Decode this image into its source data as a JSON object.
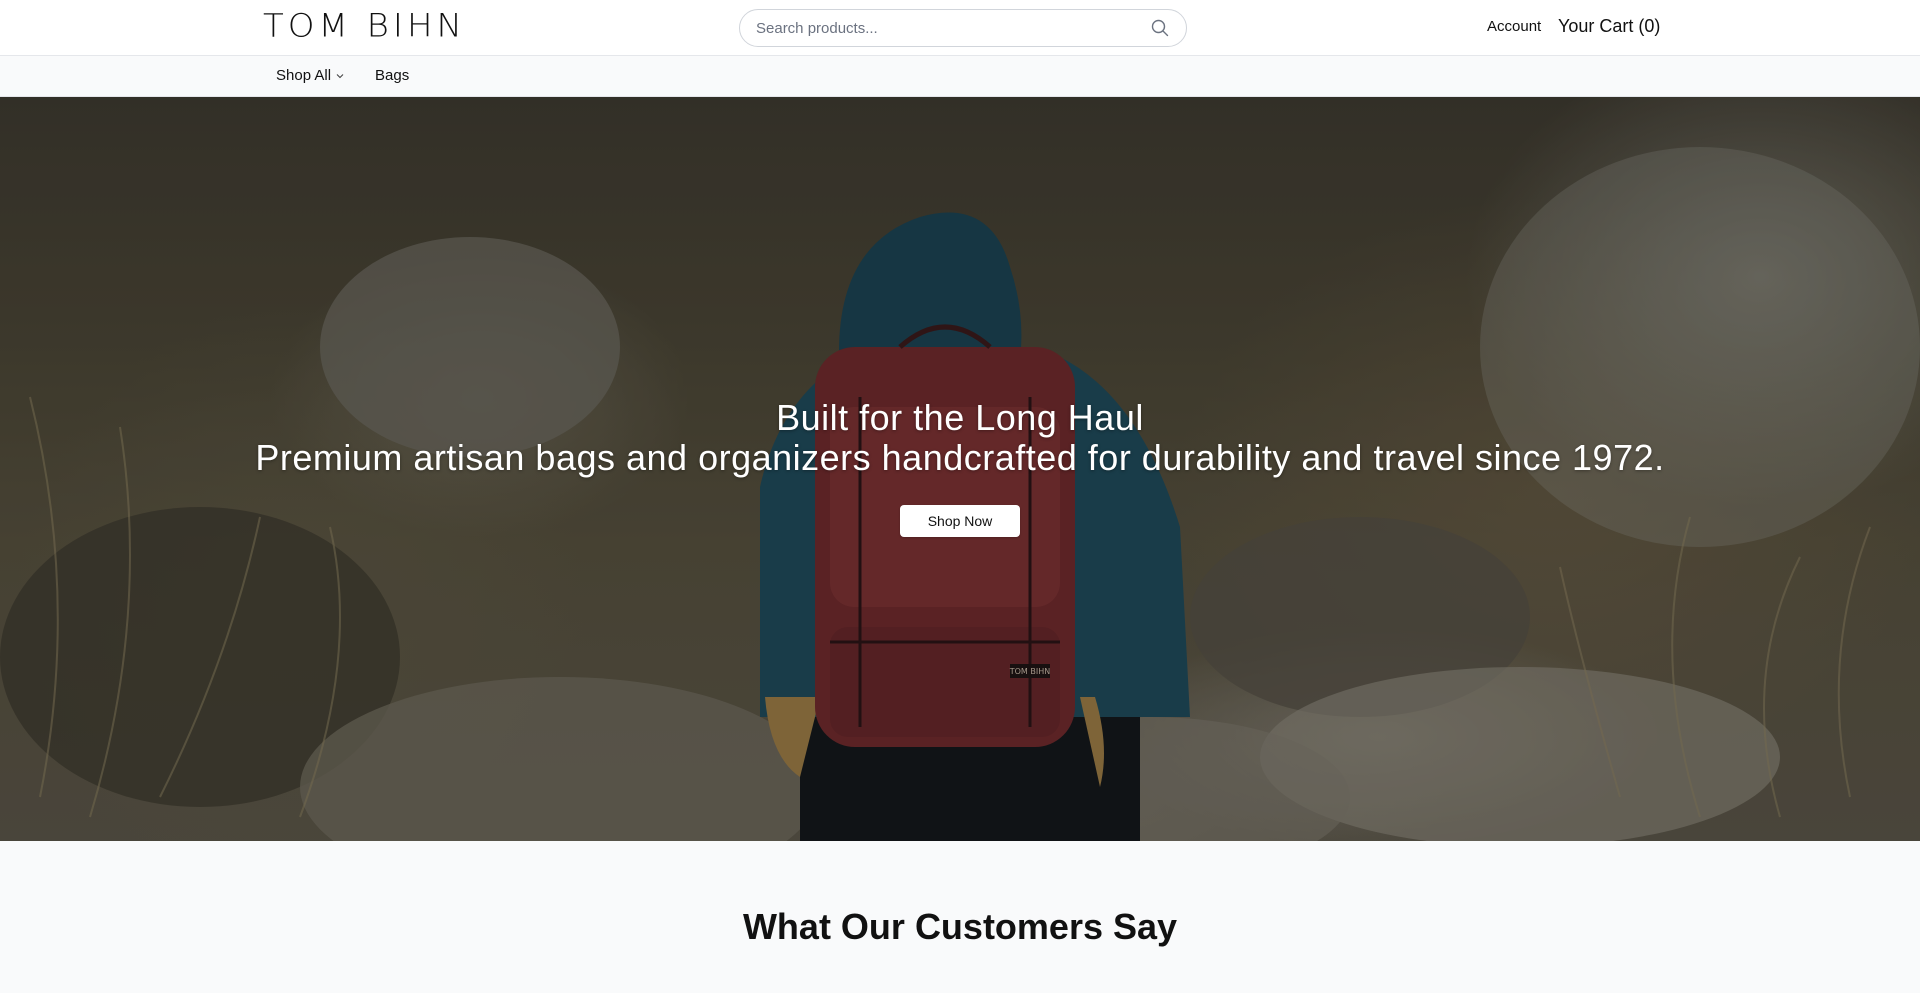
{
  "header": {
    "logo_text": "TOM BIHN",
    "search_placeholder": "Search products...",
    "search_icon": "search-icon",
    "account_label": "Account",
    "cart_label": "Your Cart (0)"
  },
  "nav": {
    "items": [
      {
        "label": "Shop All",
        "has_dropdown": true,
        "icon": "chevron-down-icon"
      },
      {
        "label": "Bags",
        "has_dropdown": false
      }
    ]
  },
  "hero": {
    "title": "Built for the Long Haul",
    "subtitle": "Premium artisan bags and organizers handcrafted for durability and travel since 1972.",
    "cta_label": "Shop Now",
    "backpack_logo": "TOM BIHN"
  },
  "testimonials": {
    "title": "What Our Customers Say"
  },
  "colors": {
    "header_bg": "#ffffff",
    "nav_bg": "#f9fafb",
    "page_bg": "#f9fafb",
    "backpack": "#6e2a2c",
    "jacket": "#1f4a5a",
    "text": "#111111"
  }
}
